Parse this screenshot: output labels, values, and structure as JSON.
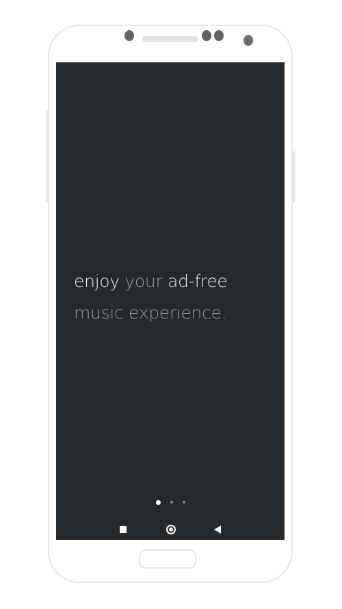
{
  "onboarding": {
    "headline": {
      "line1": {
        "part1": "enjoy",
        "part2": "your",
        "part3": "ad-free"
      },
      "line2": "music experience."
    },
    "pager": {
      "total": 3,
      "current": 1
    }
  },
  "navigation": {
    "recents": "recents-icon",
    "home": "home-icon",
    "back": "back-icon"
  },
  "colors": {
    "screen_background": "#25292c",
    "text_strong": "#e9ebec",
    "text_dim": "#9a9d9f",
    "device_frame": "#ffffff"
  }
}
